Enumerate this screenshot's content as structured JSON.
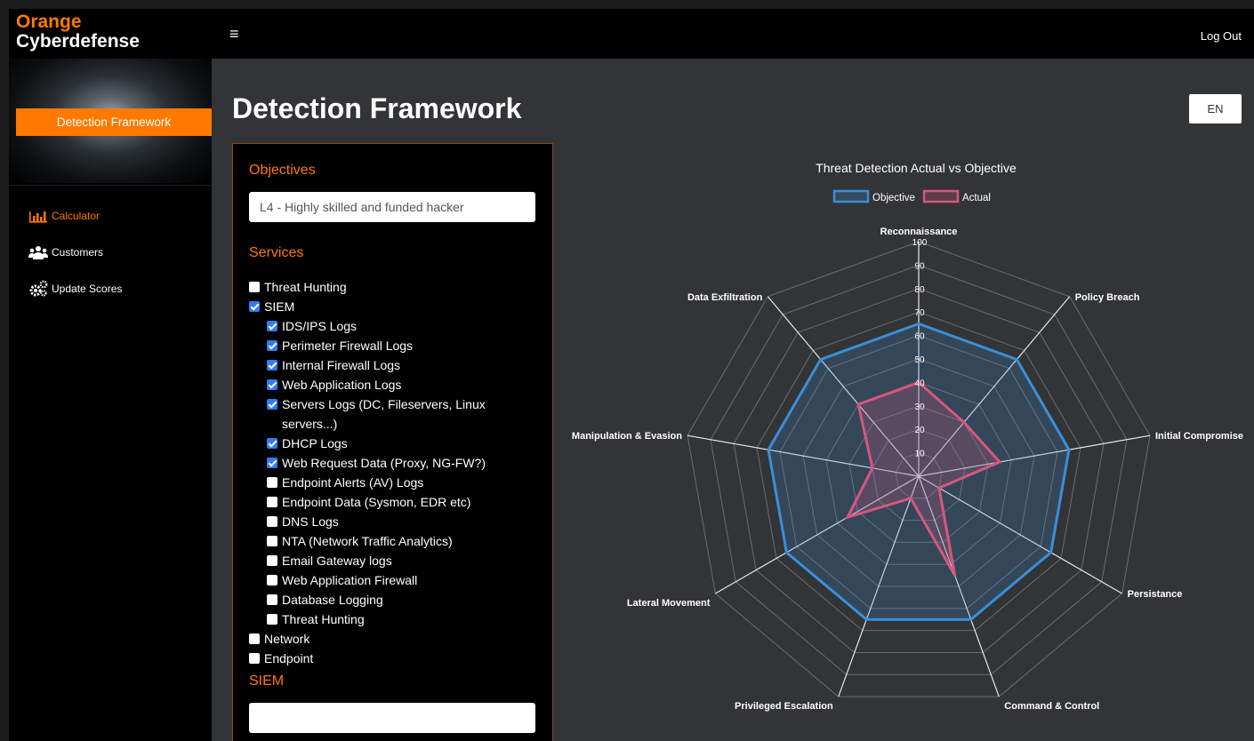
{
  "brand": {
    "line1": "Orange",
    "line2": "Cyberdefense"
  },
  "header": {
    "menu_icon": "hamburger-icon",
    "logout": "Log Out"
  },
  "sidebar": {
    "hero_button": "Detection Framework",
    "items": [
      {
        "label": "Calculator",
        "icon": "bar-chart-icon",
        "active": true
      },
      {
        "label": "Customers",
        "icon": "users-icon",
        "active": false
      },
      {
        "label": "Update Scores",
        "icon": "gears-icon",
        "active": false
      }
    ]
  },
  "page": {
    "title": "Detection Framework",
    "lang": "EN"
  },
  "form": {
    "objectives_heading": "Objectives",
    "objective_value": "L4 - Highly skilled and funded hacker",
    "services_heading": "Services",
    "siem_heading": "SIEM",
    "siem_value": "",
    "services": [
      {
        "label": "Threat Hunting",
        "checked": false,
        "indent": 0
      },
      {
        "label": "SIEM",
        "checked": true,
        "indent": 0
      },
      {
        "label": "IDS/IPS Logs",
        "checked": true,
        "indent": 1
      },
      {
        "label": "Perimeter Firewall Logs",
        "checked": true,
        "indent": 1
      },
      {
        "label": "Internal Firewall Logs",
        "checked": true,
        "indent": 1
      },
      {
        "label": "Web Application Logs",
        "checked": true,
        "indent": 1
      },
      {
        "label": "Servers Logs (DC, Fileservers, Linux servers...)",
        "checked": true,
        "indent": 1
      },
      {
        "label": "DHCP Logs",
        "checked": true,
        "indent": 1
      },
      {
        "label": "Web Request Data (Proxy, NG-FW?)",
        "checked": true,
        "indent": 1
      },
      {
        "label": "Endpoint Alerts (AV) Logs",
        "checked": false,
        "indent": 1
      },
      {
        "label": "Endpoint Data (Sysmon, EDR etc)",
        "checked": false,
        "indent": 1
      },
      {
        "label": "DNS Logs",
        "checked": false,
        "indent": 1
      },
      {
        "label": "NTA (Network Traffic Analytics)",
        "checked": false,
        "indent": 1
      },
      {
        "label": "Email Gateway logs",
        "checked": false,
        "indent": 1
      },
      {
        "label": "Web Application Firewall",
        "checked": false,
        "indent": 1
      },
      {
        "label": "Database Logging",
        "checked": false,
        "indent": 1
      },
      {
        "label": "Threat Hunting",
        "checked": false,
        "indent": 1
      },
      {
        "label": "Network",
        "checked": false,
        "indent": 0
      },
      {
        "label": "Endpoint",
        "checked": false,
        "indent": 0
      }
    ]
  },
  "chart_data": {
    "type": "radar",
    "title": "Threat Detection Actual vs Objective",
    "legend_position": "top",
    "axes": [
      "Reconnaissance",
      "Policy Breach",
      "Initial Compromise",
      "Persistance",
      "Command & Control",
      "Privileged Escalation",
      "Lateral Movement",
      "Manipulation & Evasion",
      "Data Exfiltration"
    ],
    "range": [
      0,
      100
    ],
    "ticks": [
      10,
      20,
      30,
      40,
      50,
      60,
      70,
      80,
      90,
      100
    ],
    "series": [
      {
        "name": "Objective",
        "color": "#3a8fd8",
        "values": [
          65,
          65,
          65,
          65,
          65,
          65,
          65,
          65,
          65
        ]
      },
      {
        "name": "Actual",
        "color": "#d6577f",
        "values": [
          40,
          30,
          35,
          10,
          45,
          10,
          35,
          20,
          40
        ]
      }
    ]
  }
}
